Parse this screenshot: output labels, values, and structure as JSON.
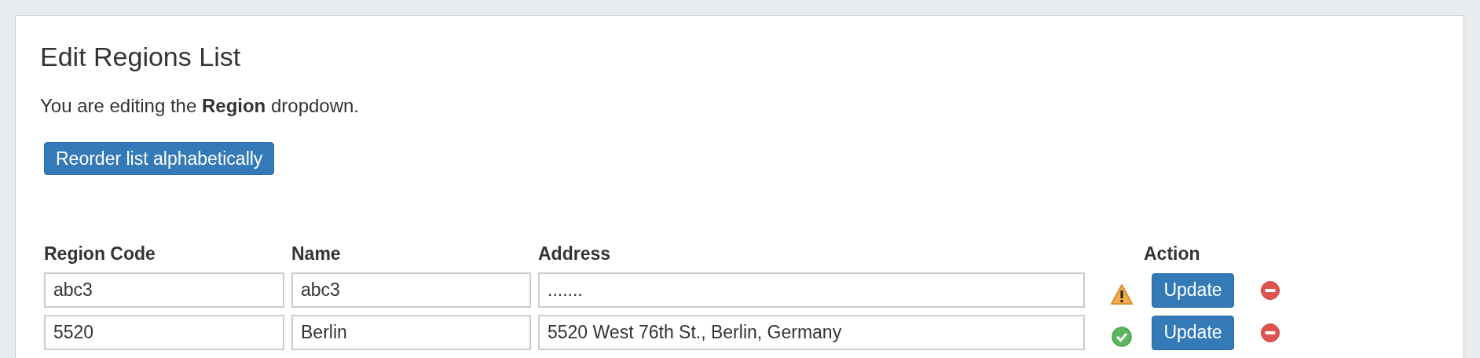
{
  "title": "Edit Regions List",
  "intro": "You are editing the **Region** dropdown.",
  "reorder_button": "Reorder list alphabetically",
  "table": {
    "columns": [
      "Region Code",
      "Name",
      "Address",
      "Action"
    ],
    "rows": [
      {
        "code": "abc3",
        "name": "abc3",
        "address": ".......",
        "kind": "warning",
        "action": "Update"
      },
      {
        "code": "5520",
        "name": "Berlin",
        "address": "5520 West 76th St., Berlin, Germany",
        "kind": "ok",
        "action": "Update"
      }
    ]
  }
}
